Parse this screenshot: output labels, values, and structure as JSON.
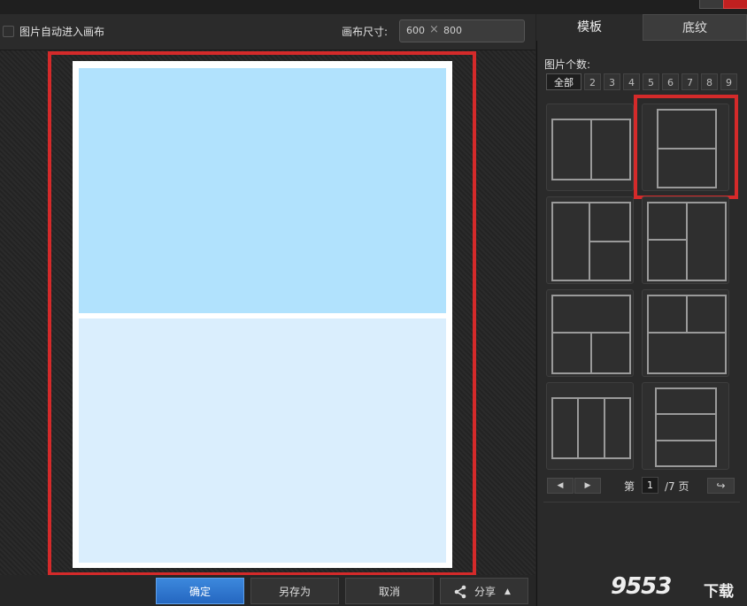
{
  "toolbar": {
    "auto_fit_label": "图片自动进入画布",
    "canvas_size_label": "画布尺寸:",
    "canvas_width": "600",
    "size_separator": "×",
    "canvas_height": "800"
  },
  "actions": {
    "confirm": "确定",
    "save_as": "另存为",
    "cancel": "取消",
    "share": "分享",
    "share_arrow": "▲"
  },
  "sidebar": {
    "tabs": [
      "模板",
      "底纹"
    ],
    "count_label": "图片个数:",
    "counts": [
      "全部",
      "2",
      "3",
      "4",
      "5",
      "6",
      "7",
      "8",
      "9"
    ],
    "pagination": {
      "prev": "◀",
      "next": "▶",
      "prefix": "第",
      "current": "1",
      "suffix": "/7 页",
      "jump": "↪"
    }
  },
  "watermark": {
    "number": "9553",
    "text": "下载"
  },
  "colors": {
    "accent_red": "#d42a2a",
    "cell_top": "#b1e2fd",
    "cell_bottom": "#daeefd",
    "primary_button": "#2f78d2"
  }
}
